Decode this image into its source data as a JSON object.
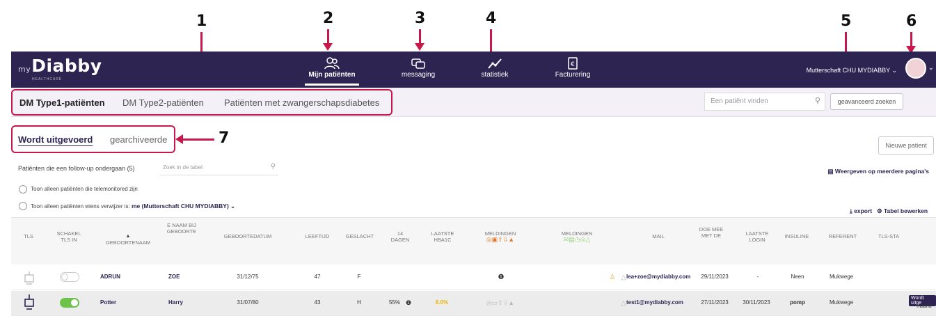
{
  "annotations": [
    "1",
    "2",
    "3",
    "4",
    "5",
    "6",
    "7"
  ],
  "brand": {
    "prefix": "my",
    "name": "Diabby",
    "sub": "HEALTHCARE"
  },
  "nav": [
    {
      "label": "Mijn patiënten",
      "icon": "patients-icon",
      "active": true
    },
    {
      "label": "messaging",
      "icon": "messages-icon"
    },
    {
      "label": "statistiek",
      "icon": "chart-icon"
    },
    {
      "label": "Facturering",
      "icon": "billing-icon"
    }
  ],
  "user": {
    "name": "Mutterschaft CHU MYDIABBY"
  },
  "subtabs": [
    "DM Type1-patiënten",
    "DM Type2-patiënten",
    "Patiënten met zwangerschapsdiabetes"
  ],
  "search": {
    "placeholder": "Een patiënt vinden",
    "advanced": "geavanceerd zoeken"
  },
  "tabs": {
    "active": "Wordt uitgevoerd",
    "archived": "gearchiveerde"
  },
  "new_patient": "Nieuwe patient",
  "followup": {
    "label": "Patiënten die een follow-up ondergaan (5)",
    "placeholder": "Zoek in de tabel"
  },
  "multipage": "Weergeven op meerdere pagina's",
  "filters": {
    "telemonitored": "Toon alleen patiënten die telemonitored zijn",
    "referrer_prefix": "Toon alleen patiënten wiens verwijzer is:",
    "referrer_value": "me (Mutterschaft CHU MYDIABBY)"
  },
  "actions": {
    "export": "export",
    "edit": "Tabel bewerken"
  },
  "columns": [
    "TLS",
    "SCHAKEL TLS IN",
    "GEBOORTENAAM",
    "E NAAM BIJ GEBOORTE",
    "GEBOORTEDATUM",
    "LEEFTIJD",
    "GESLACHT",
    "14 DAGEN",
    "LAATSTE HBA1C",
    "MELDINGEN",
    "MELDINGEN",
    "MAIL",
    "DOE MEE MET DE",
    "LAATSTE LOGIN",
    "INSULINE",
    "REFERENT",
    "TLS-STA"
  ],
  "rows": [
    {
      "lastname": "ADRUN",
      "firstname": "ZOE",
      "dob": "31/12/75",
      "age": "47",
      "sex": "F",
      "days14": "",
      "hba1c": "",
      "mail": "lea+zoe@mydiabby.com",
      "joined": "29/11/2023",
      "login": "-",
      "insulin": "Neen",
      "referent": "Mukwege",
      "tls_on": false,
      "status": ""
    },
    {
      "lastname": "Potter",
      "firstname": "Harry",
      "dob": "31/07/80",
      "age": "43",
      "sex": "H",
      "days14": "55%",
      "hba1c": "8.0%",
      "mail": "test1@mydiabby.com",
      "joined": "27/11/2023",
      "login": "30/11/2023",
      "insulin": "pomp",
      "referent": "Mukwege",
      "tls_on": true,
      "status": "Wordt uitge",
      "status2": "maand"
    }
  ]
}
